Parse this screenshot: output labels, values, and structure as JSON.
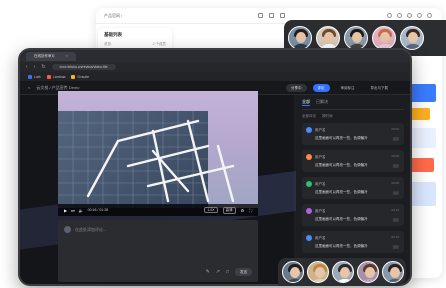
{
  "background_window": {
    "breadcrumb": "产品官网 /",
    "card_title": "基础列表",
    "card_sub_left": "总览",
    "card_sub_right": "2 个成员"
  },
  "browser": {
    "tab_title": "在线协作审片",
    "url": "xxxx.feishu.cn/review/video-file",
    "bookmarks": [
      "Lark",
      "Lambda",
      "Dvsuite"
    ]
  },
  "header": {
    "crumb_back": "<",
    "crumb_title": "云文档 / 产品宣传 Demo",
    "btn_share": "分享中",
    "btn_comment": "评论",
    "btn_edit": "审阅标注",
    "btn_more": "导出与下载"
  },
  "video": {
    "time": "00:16 / 01:28",
    "speed": "1.0X",
    "quality": "高清"
  },
  "comment_input": {
    "placeholder": "在此处添加评论...",
    "send_label": "发送"
  },
  "panel": {
    "tab_comments": "全部",
    "tab_other": "已解决",
    "filter_all": "全部评论",
    "filter_sort": "按时间",
    "comments": [
      {
        "name": "用户名",
        "time": "00:02",
        "body": "这里画面可以再亮一些，色调偏冷",
        "meta": "回复",
        "color": "#4a8cff"
      },
      {
        "name": "用户名",
        "time": "00:05",
        "body": "这里画面可以再亮一些，色调偏冷",
        "meta": "回复",
        "color": "#ff8a3d"
      },
      {
        "name": "用户名",
        "time": "00:09",
        "body": "这里画面可以再亮一些，色调偏冷",
        "meta": "回复",
        "color": "#2fbf71"
      },
      {
        "name": "用户名",
        "time": "00:12",
        "body": "这里画面可以再亮一些，色调偏冷",
        "meta": "回复",
        "color": "#b060e0"
      },
      {
        "name": "用户名",
        "time": "00:16",
        "body": "这里画面可以再亮一些，色调偏冷",
        "meta": "回复",
        "color": "#4a8cff"
      }
    ]
  },
  "colors": {
    "accent": "#3370ff",
    "dark_bg": "#1d1f23"
  }
}
